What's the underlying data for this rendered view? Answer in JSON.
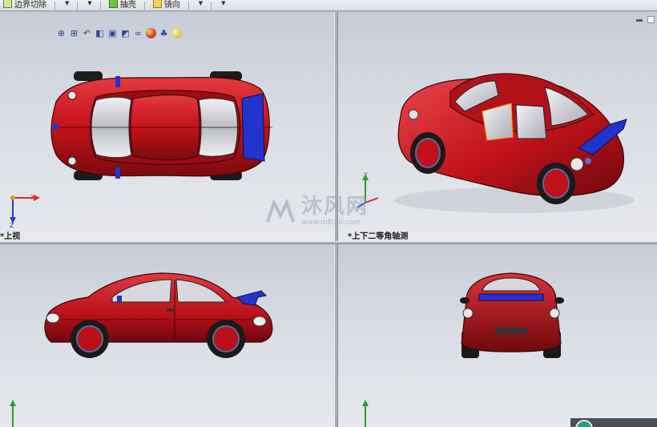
{
  "toolbar": {
    "items": [
      {
        "label": "边界切除",
        "icon": "boundary-cut-icon"
      },
      {
        "label": "",
        "icon": "dropdown-icon"
      },
      {
        "label": "",
        "icon": "dropdown-icon"
      },
      {
        "label": "抽壳",
        "icon": "shell-icon"
      },
      {
        "label": "镜向",
        "icon": "mirror-icon"
      },
      {
        "label": "",
        "icon": "dropdown-icon"
      },
      {
        "label": "",
        "icon": "dropdown-icon"
      }
    ]
  },
  "view_toolbar": {
    "icons": [
      "zoom-to-fit-icon",
      "zoom-area-icon",
      "previous-view-icon",
      "section-view-icon",
      "view-orientation-icon",
      "display-style-icon",
      "hide-show-items-icon",
      "edit-appearance-icon",
      "apply-scene-icon",
      "view-settings-icon"
    ]
  },
  "viewports": {
    "top_left": {
      "label": "*上视"
    },
    "top_right": {
      "label": "*上下二等角轴测"
    },
    "bottom_left": {
      "label": ""
    },
    "bottom_right": {
      "label": ""
    }
  },
  "triad": {
    "x": "X",
    "y": "Y",
    "z": "Z"
  },
  "watermark": {
    "text": "沐风网",
    "url": "www.mfcad.com"
  },
  "colors": {
    "car_body": "#c4121a",
    "car_dark": "#7a0a0e",
    "glass": "#c9ccd2",
    "spoiler": "#2233cc",
    "triad_x": "#d03030",
    "triad_y": "#2a9a2a",
    "triad_z": "#2a3ad0"
  }
}
